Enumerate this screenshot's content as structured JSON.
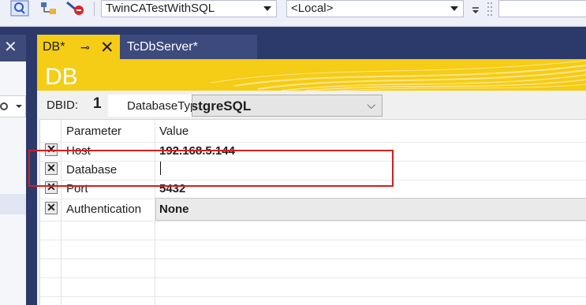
{
  "toolbar": {
    "solution_combo": "TwinCATestWithSQL",
    "target_combo": "<Local>"
  },
  "left_panel": {
    "close_glyph": "✕"
  },
  "tabs": [
    {
      "label": "DB*",
      "pin_glyph": "⊸",
      "close_glyph": "✕"
    },
    {
      "label": "TcDbServer*"
    }
  ],
  "editor": {
    "banner_title": "DB",
    "dbid_label": "DBID:",
    "dbid_value": "1",
    "dbtype_label": "DatabaseType",
    "dbtype_value": "PostgreSQL",
    "dbtype_chevron": "⌵"
  },
  "grid": {
    "headers": {
      "parameter": "Parameter",
      "value": "Value"
    },
    "rows": [
      {
        "check": "✕",
        "name": "Host",
        "value": "192.168.5.144"
      },
      {
        "check": "✕",
        "name": "Database",
        "value": ""
      },
      {
        "check": "✕",
        "name": "Port",
        "value": "5432"
      },
      {
        "check": "✕",
        "name": "Authentication",
        "value": "None"
      }
    ]
  },
  "colors": {
    "accent_yellow": "#f5cc16",
    "frame_blue": "#2c3a6b",
    "highlight_red": "#d21f1f"
  }
}
